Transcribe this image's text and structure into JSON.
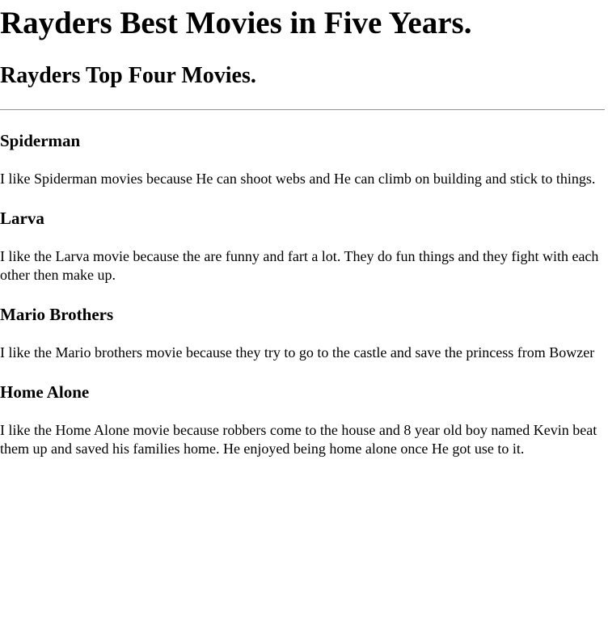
{
  "page": {
    "title": "Rayders Best Movies in Five Years.",
    "subtitle": "Rayders Top Four Movies."
  },
  "movies": [
    {
      "title": "Spiderman",
      "description": "I like Spiderman movies because He can shoot webs and He can climb on building and stick to things."
    },
    {
      "title": "Larva",
      "description": "I like the Larva movie because the are funny and fart a lot. They do fun things and they fight with each other then make up."
    },
    {
      "title": "Mario Brothers",
      "description": "I like the Mario brothers movie because they try to go to the castle and save the princess from Bowzer"
    },
    {
      "title": "Home Alone",
      "description": "I like the Home Alone movie because robbers come to the house and 8 year old boy named Kevin beat them up and saved his families home. He enjoyed being home alone once He got use to it."
    }
  ]
}
